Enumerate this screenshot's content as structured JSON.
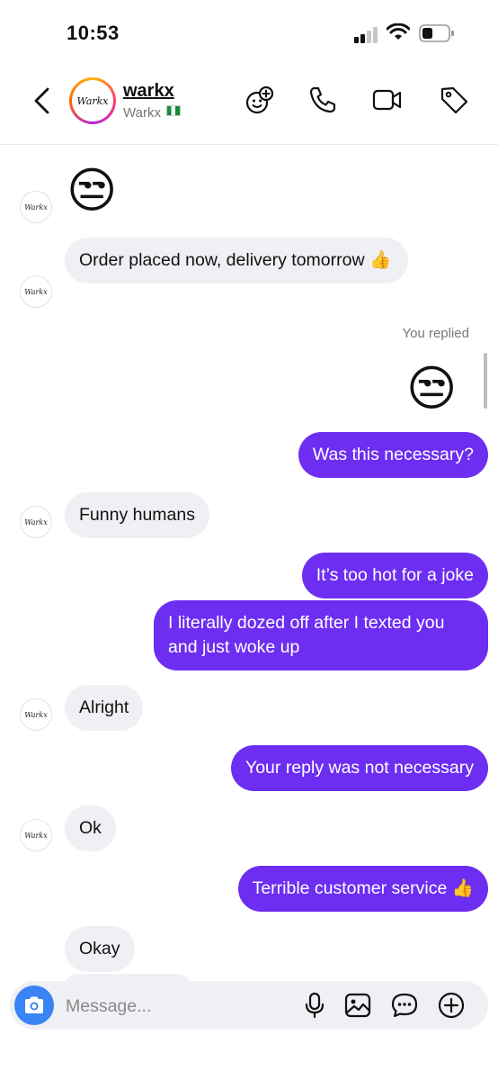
{
  "status_bar": {
    "time": "10:53"
  },
  "header": {
    "name": "warkx",
    "handle": "Warkx",
    "avatar_text": "Warkx",
    "icons": [
      "effects-icon",
      "phone-icon",
      "video-icon",
      "tag-icon"
    ]
  },
  "messages": {
    "m1": "😒",
    "m2": "Order placed now, delivery tomorrow 👍",
    "you_replied": "You replied",
    "m3": "😒",
    "m4": "Was this necessary?",
    "m5": "Funny humans",
    "m6": "It’s too hot for a joke",
    "m7": "I literally dozed off after I texted you and just woke up",
    "m8": "Alright",
    "m9": "Your reply was not necessary",
    "m10": "Ok",
    "m11": "Terrible customer service 👍",
    "m12": "Okay"
  },
  "composer": {
    "placeholder": "Message..."
  },
  "colors": {
    "outgoing": "#6d2ef2",
    "incoming": "#eff0f4",
    "camera": "#3a84f5"
  }
}
